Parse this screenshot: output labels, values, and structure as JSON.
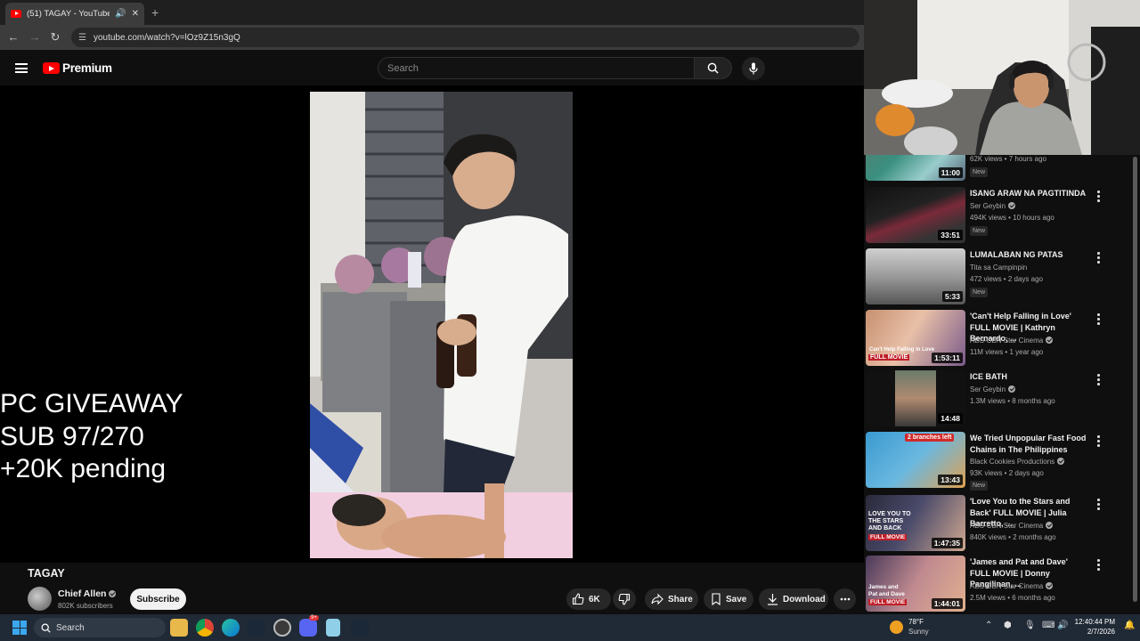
{
  "browser": {
    "tab_title": "(51) TAGAY - YouTube",
    "new_tab": "+",
    "url": "youtube.com/watch?v=lOz9Z15n3gQ"
  },
  "youtube": {
    "logo_text": "Premium",
    "search_placeholder": "Search"
  },
  "overlay": {
    "line1": "PC GIVEAWAY",
    "line2": "SUB 97/270",
    "line3": "+20K pending"
  },
  "video": {
    "title": "TAGAY",
    "channel": "Chief Allen",
    "subscribers": "802K subscribers",
    "subscribe_label": "Subscribe",
    "like_count": "6K",
    "share_label": "Share",
    "save_label": "Save",
    "download_label": "Download"
  },
  "recommendations": [
    {
      "title": "",
      "channel": "",
      "meta": "62K views • 7 hours ago",
      "duration": "11:00",
      "badge": "New"
    },
    {
      "title": "ISANG ARAW NA PAGTITINDA",
      "channel": "Ser Geybin",
      "meta": "494K views • 10 hours ago",
      "duration": "33:51",
      "badge": "New"
    },
    {
      "title": "LUMALABAN NG PATAS",
      "channel": "Tita sa Campinpin",
      "meta": "472 views • 2 days ago",
      "duration": "5:33",
      "badge": "New"
    },
    {
      "title": "'Can't Help Falling in Love' FULL MOVIE | Kathryn Bernardo, ...",
      "channel": "ABS-CBN Star Cinema",
      "meta": "11M views • 1 year ago",
      "duration": "1:53:11",
      "badge": ""
    },
    {
      "title": "ICE BATH",
      "channel": "Ser Geybin",
      "meta": "1.3M views • 8 months ago",
      "duration": "14:48",
      "badge": ""
    },
    {
      "title": "We Tried Unpopular Fast Food Chains in The Philippines",
      "channel": "Black Cookies Productions",
      "meta": "93K views • 2 days ago",
      "duration": "13:43",
      "badge": "New"
    },
    {
      "title": "'Love You to the Stars and Back' FULL MOVIE | Julia Barretto, ...",
      "channel": "ABS-CBN Star Cinema",
      "meta": "840K views • 2 months ago",
      "duration": "1:47:35",
      "badge": ""
    },
    {
      "title": "'James and Pat and Dave' FULL MOVIE | Donny Pangilinan, ...",
      "channel": "ABS-CBN Star Cinema",
      "meta": "2.5M views • 6 months ago",
      "duration": "1:44:01",
      "badge": ""
    }
  ],
  "thumb_text": {
    "t4": "Can't Help Falling in Love",
    "t4b": "FULL MOVIE",
    "t6": "2 branches left",
    "t7a": "LOVE YOU TO",
    "t7b": "THE STARS",
    "t7c": "AND BACK",
    "t7d": "FULL MOVIE",
    "t8a": "James and",
    "t8b": "Pat and Dave",
    "t8c": "FULL MOVIE"
  },
  "taskbar": {
    "search_label": "Search",
    "temperature": "78°F",
    "condition": "Sunny",
    "time": "12:40:44 PM",
    "date": "2/7/2026",
    "discord_badge": "9+"
  }
}
